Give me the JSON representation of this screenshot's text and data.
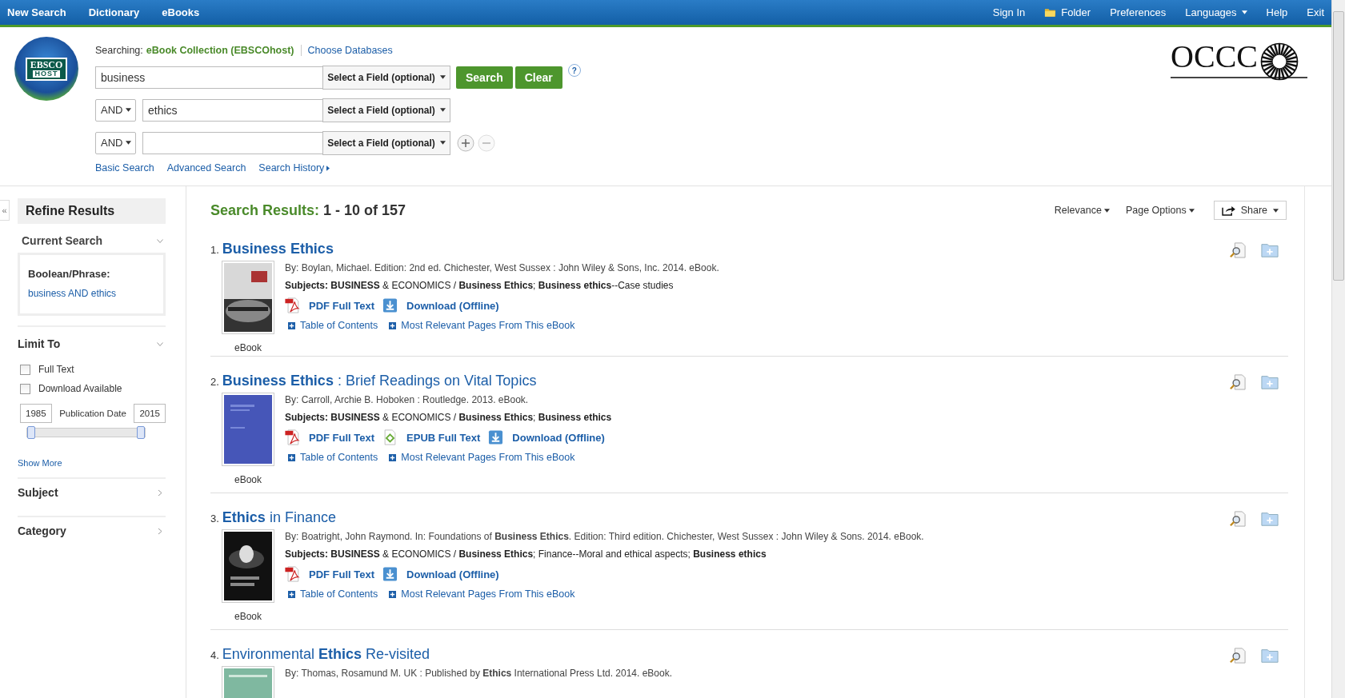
{
  "top_nav": {
    "left": [
      {
        "label": "New Search"
      },
      {
        "label": "Dictionary"
      },
      {
        "label": "eBooks"
      }
    ],
    "right": [
      {
        "label": "Sign In",
        "kind": "text"
      },
      {
        "label": "Folder",
        "kind": "folder"
      },
      {
        "label": "Preferences",
        "kind": "text"
      },
      {
        "label": "Languages",
        "kind": "dropdown"
      },
      {
        "label": "Help",
        "kind": "text"
      },
      {
        "label": "Exit",
        "kind": "text"
      }
    ]
  },
  "logo": {
    "line1": "EBSCO",
    "line2": "HOST"
  },
  "searching": {
    "label": "Searching:",
    "database": "eBook Collection (EBSCOhost)",
    "choose": "Choose Databases"
  },
  "search_rows": [
    {
      "operator": null,
      "value": "business",
      "field": "Select a Field (optional)"
    },
    {
      "operator": "AND",
      "value": "ethics",
      "field": "Select a Field (optional)"
    },
    {
      "operator": "AND",
      "value": "",
      "field": "Select a Field (optional)"
    }
  ],
  "search_button": "Search",
  "clear_button": "Clear",
  "help": "?",
  "add_row": {
    "disabled": false
  },
  "remove_row": {
    "disabled": true
  },
  "search_links": [
    {
      "label": "Basic Search",
      "caret": false
    },
    {
      "label": "Advanced Search",
      "caret": false
    },
    {
      "label": "Search History",
      "caret": true
    }
  ],
  "institution_logo": {
    "text": "OCCC"
  },
  "sidebar": {
    "collapse": "«",
    "title": "Refine Results",
    "current_search": {
      "title": "Current Search",
      "expanded": true,
      "label": "Boolean/Phrase:",
      "query": "business AND ethics"
    },
    "limit_to": {
      "title": "Limit To",
      "expanded": true,
      "options": [
        {
          "label": "Full Text",
          "checked": false
        },
        {
          "label": "Download Available",
          "checked": false
        }
      ],
      "date_from": "1985",
      "date_label": "Publication Date",
      "date_to": "2015",
      "level": 1,
      "show_more": "Show More"
    },
    "facets": [
      {
        "title": "Subject",
        "expanded": false
      },
      {
        "title": "Category",
        "expanded": false
      }
    ]
  },
  "results_header": {
    "label": "Search Results:",
    "range": "1 - 10 of 157"
  },
  "sort_controls": [
    {
      "label": "Relevance",
      "kind": "menu"
    },
    {
      "label": "Page Options",
      "kind": "menu"
    },
    {
      "label": "Share",
      "kind": "share"
    }
  ],
  "results": [
    {
      "number": "1.",
      "title": "**Business Ethics**",
      "byline": "By: Boylan, Michael. Edition: 2nd ed. Chichester, West Sussex : John Wiley & Sons, Inc. 2014. eBook.",
      "subjects": "**Subjects: BUSINESS** & ECONOMICS / **Business Ethics**; **Business ethics**--Case studies",
      "links": [
        {
          "kind": "pdf",
          "label": "PDF Full Text"
        },
        {
          "kind": "download",
          "label": "Download (Offline)"
        }
      ],
      "extras": [
        "Table of Contents",
        "Most Relevant Pages From This eBook"
      ],
      "type": "eBook"
    },
    {
      "number": "2.",
      "title": "**Business Ethics** : Brief Readings on Vital Topics",
      "byline": "By: Carroll, Archie B. Hoboken : Routledge. 2013. eBook.",
      "subjects": "**Subjects: BUSINESS** & ECONOMICS / **Business Ethics**; **Business ethics**",
      "links": [
        {
          "kind": "pdf",
          "label": "PDF Full Text"
        },
        {
          "kind": "epub",
          "label": "EPUB Full Text"
        },
        {
          "kind": "download",
          "label": "Download (Offline)"
        }
      ],
      "extras": [
        "Table of Contents",
        "Most Relevant Pages From This eBook"
      ],
      "type": "eBook"
    },
    {
      "number": "3.",
      "title": "**Ethics** in Finance",
      "byline": "By: Boatright, John Raymond. In: Foundations of **Business Ethics**. Edition: Third edition. Chichester, West Sussex : John Wiley & Sons. 2014. eBook.",
      "subjects": "**Subjects: BUSINESS** & ECONOMICS / **Business Ethics**; Finance--Moral and ethical aspects; **Business ethics**",
      "links": [
        {
          "kind": "pdf",
          "label": "PDF Full Text"
        },
        {
          "kind": "download",
          "label": "Download (Offline)"
        }
      ],
      "extras": [
        "Table of Contents",
        "Most Relevant Pages From This eBook"
      ],
      "type": "eBook"
    },
    {
      "number": "4.",
      "title": "Environmental **Ethics** Re-visited",
      "byline": "By: Thomas, Rosamund M. UK : Published by **Ethics** International Press Ltd. 2014. eBook."
    }
  ]
}
